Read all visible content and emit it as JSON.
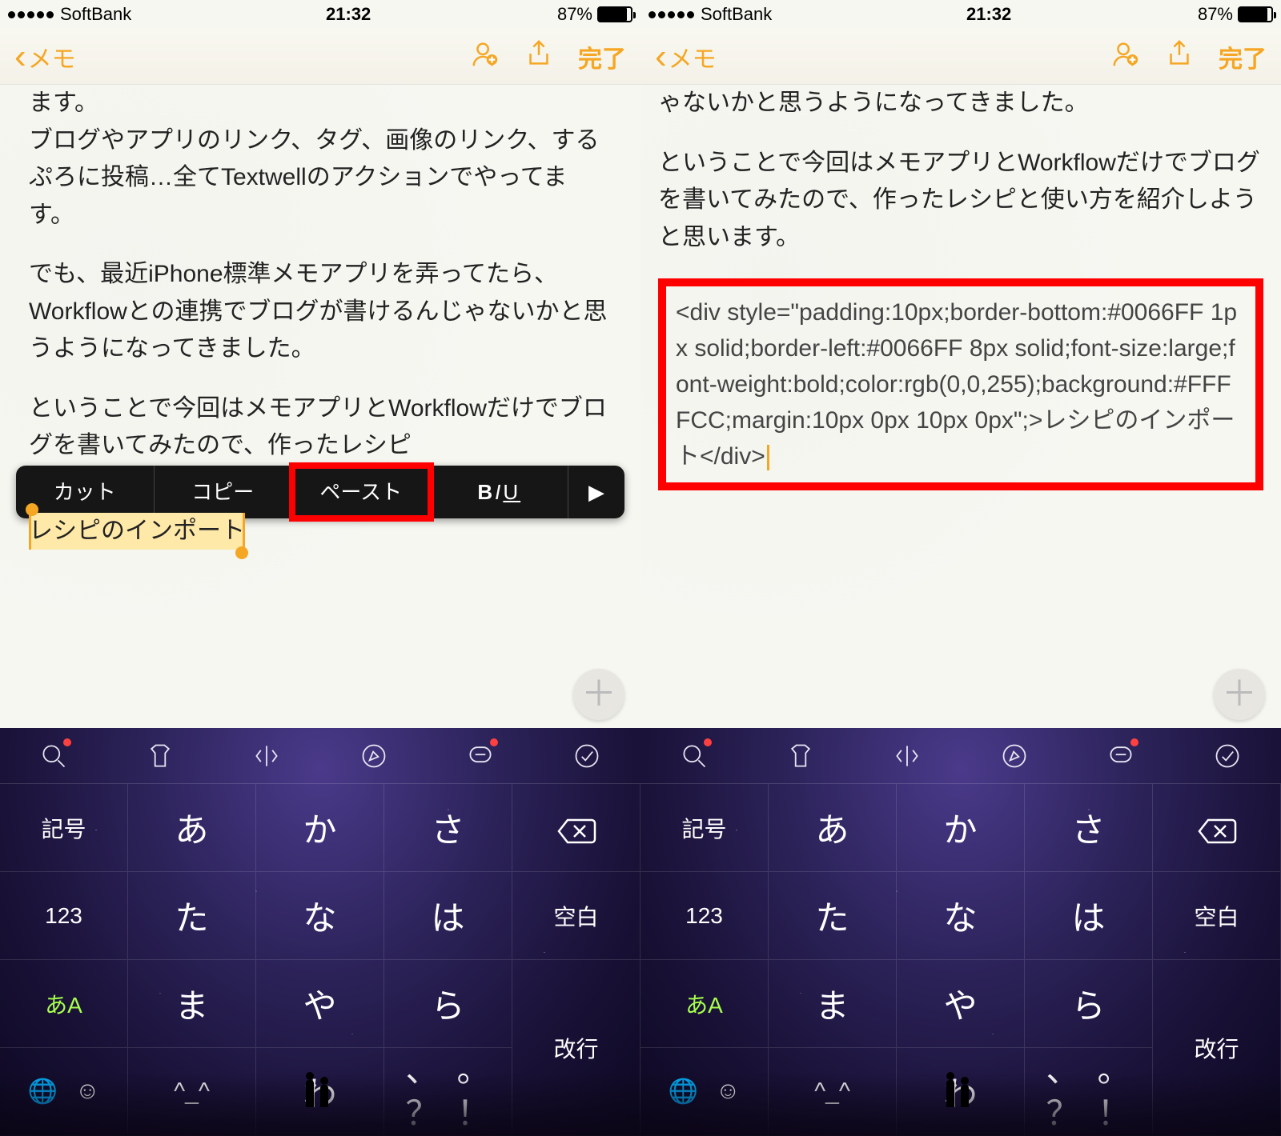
{
  "status": {
    "carrier": "SoftBank",
    "time": "21:32",
    "battery_pct": "87%"
  },
  "nav": {
    "back_label": "メモ",
    "done_label": "完了"
  },
  "left": {
    "p1": "ます。",
    "p2": "ブログやアプリのリンク、タグ、画像のリンク、するぷろに投稿…全てTextwellのアクションでやってます。",
    "p3": "でも、最近iPhone標準メモアプリを弄ってたら、Workflowとの連携でブログが書けるんじゃないかと思うようになってきました。",
    "p4": "ということで今回はメモアプリとWorkflowだけでブログを書いてみたので、作ったレシピ",
    "selected_text": "レシピのインポート",
    "menu": {
      "cut": "カット",
      "copy": "コピー",
      "paste": "ペースト",
      "biu": "BIU",
      "more": "▶"
    }
  },
  "right": {
    "p0": "ゃないかと思うようになってきました。",
    "p1": "ということで今回はメモアプリとWorkflowだけでブログを書いてみたので、作ったレシピと使い方を紹介しようと思います。",
    "code": "<div style=\"padding:10px;border-bottom:#0066FF 1px solid;border-left:#0066FF 8px solid;font-size:large;font-weight:bold;color:rgb(0,0,255);background:#FFFFCC;margin:10px 0px 10px 0px\";>レシピのインポート</div>"
  },
  "keyboard": {
    "row1": {
      "c0": "記号",
      "c1": "あ",
      "c2": "か",
      "c3": "さ",
      "c4": "⌫"
    },
    "row2": {
      "c0": "123",
      "c1": "た",
      "c2": "な",
      "c3": "は",
      "c4": "空白"
    },
    "row3": {
      "c0": "あA",
      "c1": "ま",
      "c2": "や",
      "c3": "ら"
    },
    "row4": {
      "g0": "🌐",
      "g1": "☺",
      "c1": "^_^",
      "c2": "わ",
      "p1": "、",
      "p2": "。",
      "p3": "？",
      "p4": "！",
      "ret": "改行"
    }
  }
}
